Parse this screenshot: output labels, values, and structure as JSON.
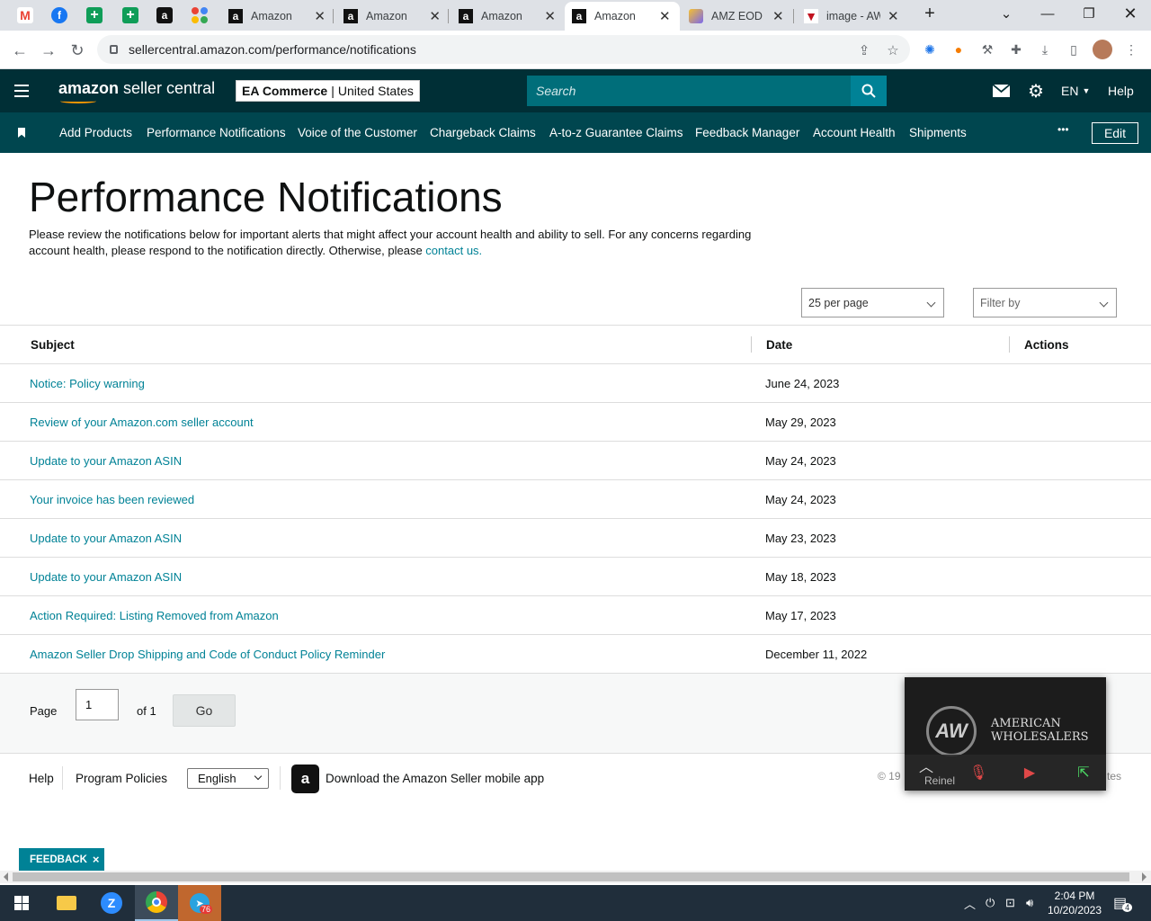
{
  "browser": {
    "pinned_tabs": [
      {
        "icon": "gmail-icon",
        "glyph": "M",
        "color": "#ea4335"
      },
      {
        "icon": "facebook-icon",
        "glyph": "f",
        "color": "#1877f2"
      },
      {
        "icon": "sheets-icon",
        "glyph": "+",
        "color": "#0f9d58"
      },
      {
        "icon": "sheets-icon",
        "glyph": "+",
        "color": "#0f9d58"
      },
      {
        "icon": "amazon-icon",
        "glyph": "a",
        "color": "#111111"
      },
      {
        "icon": "apps-icon",
        "glyph": "⁘",
        "color": "#4285f4"
      }
    ],
    "tabs": [
      {
        "label": "Amazon",
        "active": false
      },
      {
        "label": "Amazon",
        "active": false
      },
      {
        "label": "Amazon",
        "active": false
      },
      {
        "label": "Amazon",
        "active": true
      },
      {
        "label": "AMZ EOD F",
        "active": false
      },
      {
        "label": "image - AW",
        "active": false
      }
    ],
    "url": "sellercentral.amazon.com/performance/notifications"
  },
  "header": {
    "brand_bold": "amazon",
    "brand_rest": " seller central",
    "merchant_name": "EA Commerce",
    "merchant_region": "United States",
    "search_placeholder": "Search",
    "language": "EN",
    "help": "Help",
    "accent_color": "#002f36"
  },
  "subnav": {
    "links": [
      "Add Products",
      "Performance Notifications",
      "Voice of the Customer",
      "Chargeback Claims",
      "A-to-z Guarantee Claims",
      "Feedback Manager",
      "Account Health",
      "Shipments"
    ],
    "more": "•••",
    "edit": "Edit"
  },
  "page": {
    "title": "Performance Notifications",
    "intro": "Please review the notifications below for important alerts that might affect your account health and ability to sell. For any concerns regarding account health, please respond to the notification directly. Otherwise, please ",
    "contact_link": "contact us.",
    "per_page": "25 per page",
    "filter": "Filter by"
  },
  "table": {
    "columns": [
      "Subject",
      "Date",
      "Actions"
    ],
    "rows": [
      {
        "subject": "Notice: Policy warning",
        "date": "June 24, 2023"
      },
      {
        "subject": "Review of your Amazon.com seller account",
        "date": "May 29, 2023"
      },
      {
        "subject": "Update to your Amazon ASIN",
        "date": "May 24, 2023"
      },
      {
        "subject": "Your invoice has been reviewed",
        "date": "May 24, 2023"
      },
      {
        "subject": "Update to your Amazon ASIN",
        "date": "May 23, 2023"
      },
      {
        "subject": "Update to your Amazon ASIN",
        "date": "May 18, 2023"
      },
      {
        "subject": "Action Required: Listing Removed from Amazon",
        "date": "May 17, 2023"
      },
      {
        "subject": "Amazon Seller Drop Shipping and Code of Conduct Policy Reminder",
        "date": "December 11, 2022"
      }
    ]
  },
  "pagination": {
    "page_label": "Page",
    "page_value": "1",
    "of_label": "of 1",
    "go": "Go"
  },
  "footer": {
    "help": "Help",
    "program_policies": "Program Policies",
    "language": "English",
    "app_text": "Download the Amazon Seller mobile app",
    "copyright_left": "© 19",
    "copyright_right": "tes"
  },
  "video_overlay": {
    "logo_text": "AW",
    "brand_line1": "AMERICAN",
    "brand_line2": "WHOLESALERS",
    "participant": "Reinel"
  },
  "feedback": {
    "label": "FEEDBACK",
    "close": "×"
  },
  "taskbar": {
    "time": "2:04 PM",
    "date": "10/20/2023",
    "notification_count": "4",
    "telegram_badge": "76"
  }
}
